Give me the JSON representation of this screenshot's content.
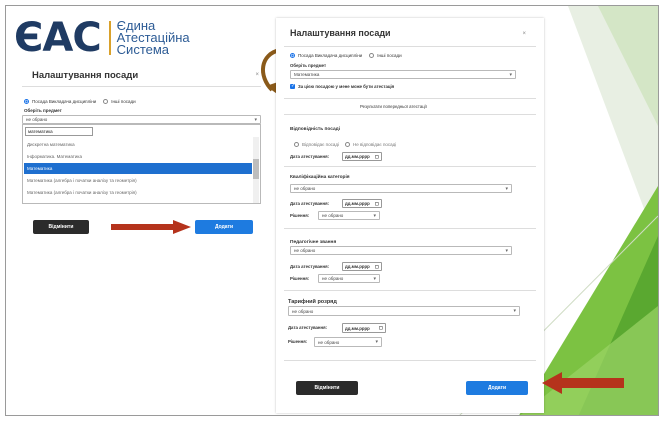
{
  "logo": {
    "mark": "ЄАС",
    "line1": "Єдина",
    "line2": "Атестаційна",
    "line3": "Система"
  },
  "left_dialog": {
    "title": "Налаштування посади",
    "close": "×",
    "radio_discipline": "Посада Викладача дисципліни",
    "radio_other": "Інші посади",
    "subject_label": "Оберіть предмет",
    "subject_value": "не обрано",
    "search_value": "математика",
    "options": [
      "Дискретна математика",
      "Інформатика. Математика",
      "Математика",
      "Математика (алгебра і початки аналізу та геометрія)",
      "Математика (алгебра і початки аналізу та геометрія)"
    ],
    "cancel_label": "Відмінити",
    "add_label": "Додати"
  },
  "right_dialog": {
    "title": "Налаштування посади",
    "close": "×",
    "radio_discipline": "Посада Викладача дисципліни",
    "radio_other": "Інші посади",
    "subject_label": "Оберіть предмет",
    "subject_value": "Математика",
    "checkbox_label": "За цією посадою у мене може бути атестація",
    "results_heading": "Результати попередньої атестації",
    "compliance": {
      "title": "Відповідність посаді",
      "opt_yes": "Відповідає посаді",
      "opt_no": "Не відповідає посаді",
      "date_label": "Дата атестування:",
      "date_placeholder": "дд.мм.рррр"
    },
    "qualification": {
      "title": "Кваліфікаційна категорія",
      "select_value": "не обрано",
      "date_label": "Дата атестування:",
      "date_placeholder": "дд.мм.рррр",
      "decision_label": "Рішення:",
      "decision_value": "не обрано"
    },
    "pedagogical": {
      "title": "Педагогічне звання",
      "select_value": "не обрано",
      "date_label": "Дата атестування:",
      "date_placeholder": "дд.мм.рррр",
      "decision_label": "Рішення:",
      "decision_value": "не обрано"
    },
    "tariff": {
      "title": "Тарифний розряд",
      "select_value": "не обрано",
      "date_label": "Дата атестування:",
      "date_placeholder": "дд.мм.рррр",
      "decision_label": "Рішення:",
      "decision_value": "не обрано"
    },
    "cancel_label": "Відмінити",
    "add_label": "Додати"
  },
  "colors": {
    "primary_blue": "#1e7be0",
    "dark_button": "#2b2b2b",
    "arrow_red": "#b5331c",
    "logo_navy": "#1f3b63",
    "deco_green": "#7cc242"
  },
  "icons": {
    "calendar": "calendar-icon",
    "chevron": "chevron-down-icon",
    "close": "close-icon"
  }
}
